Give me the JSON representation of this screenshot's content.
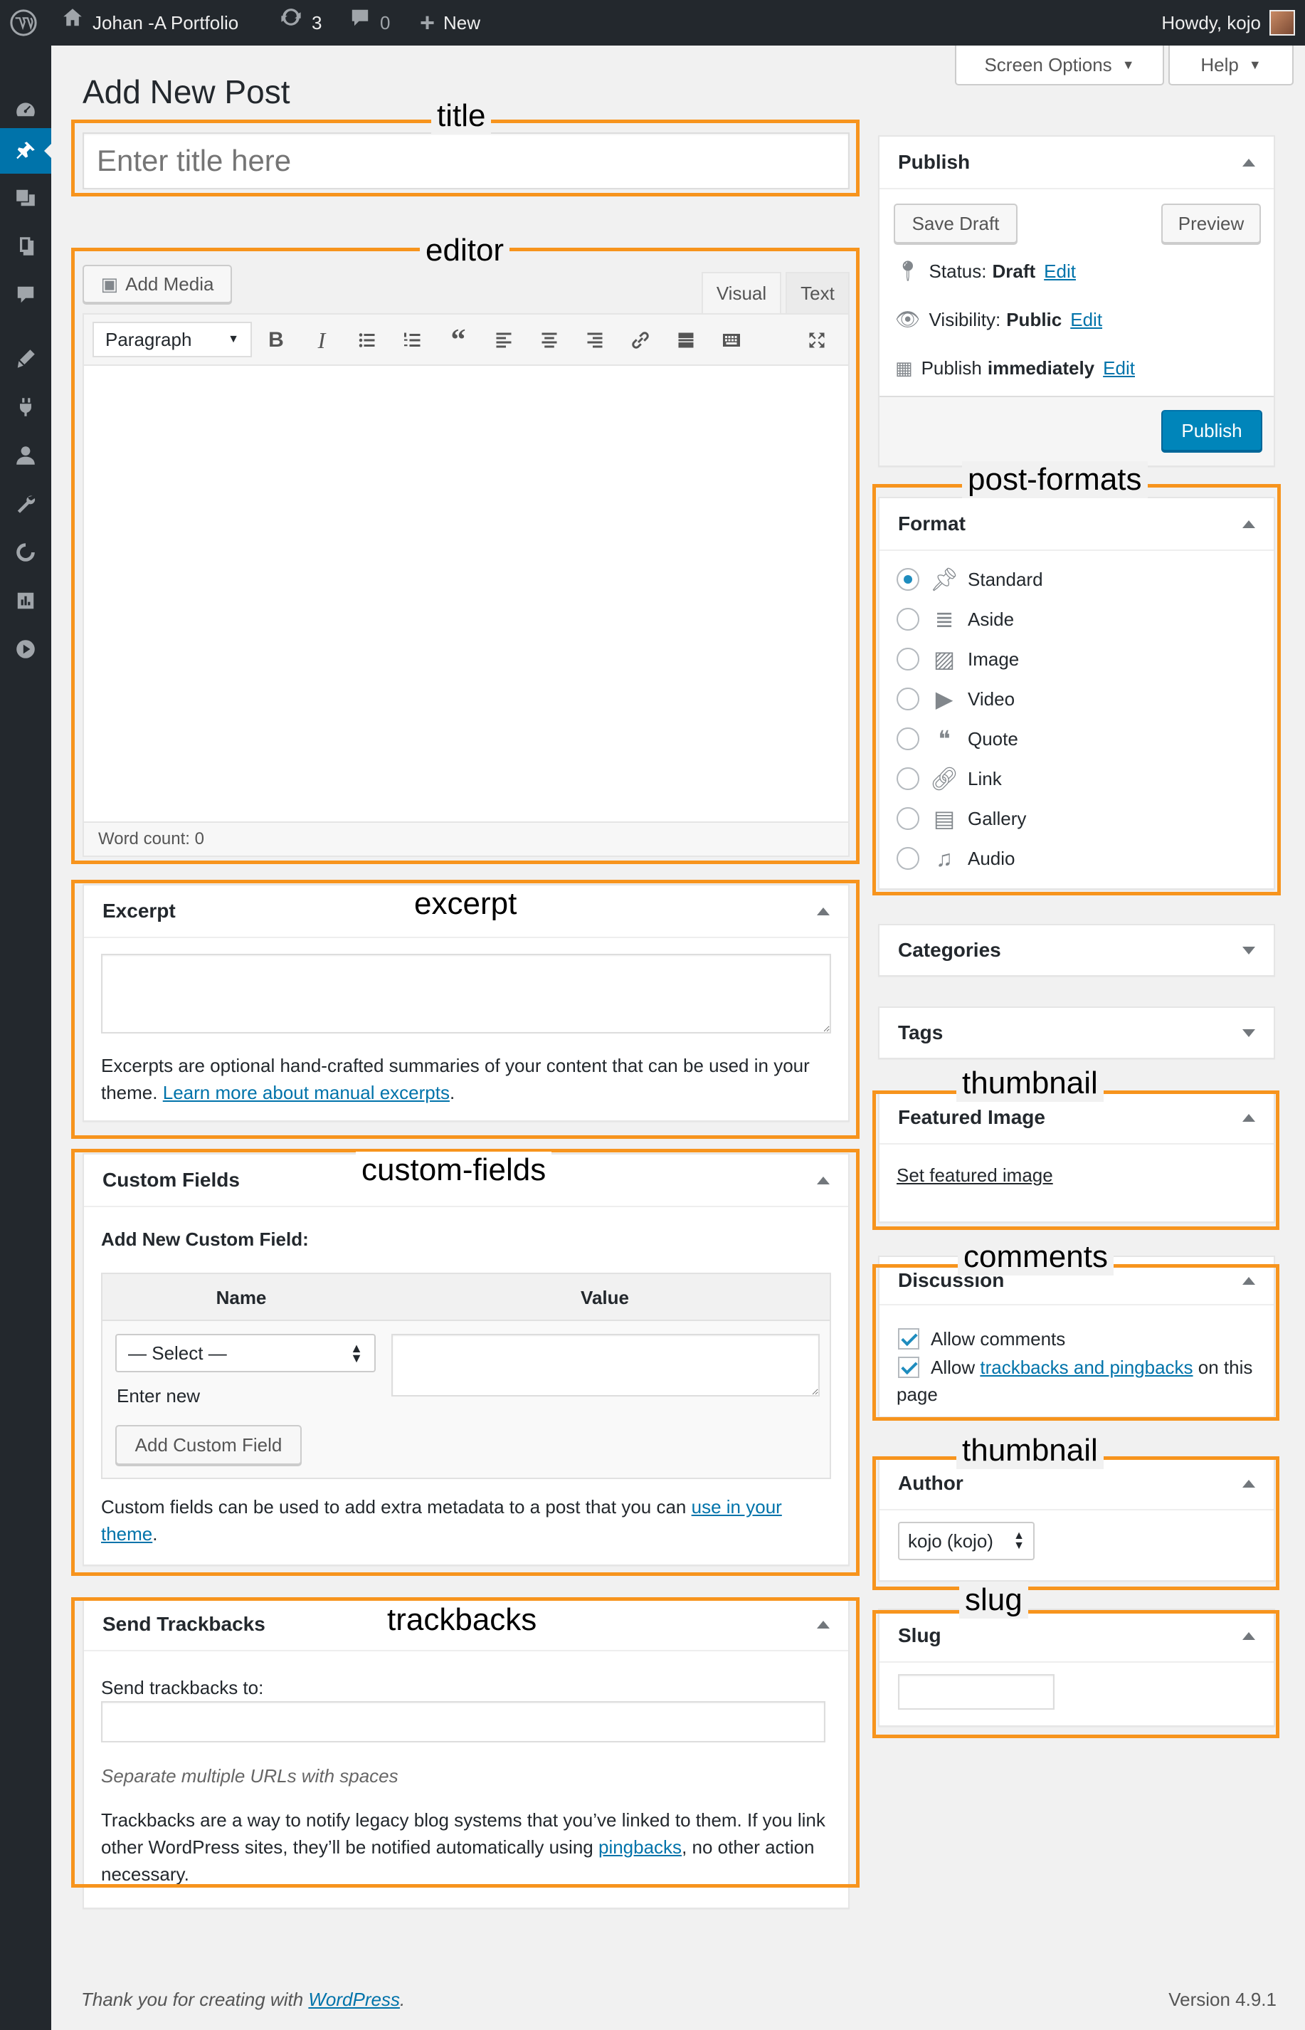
{
  "adminbar": {
    "site_name": "Johan -A Portfolio",
    "updates_count": "3",
    "comments_count": "0",
    "new_label": "New",
    "howdy": "Howdy, kojo"
  },
  "header": {
    "screen_options": "Screen Options",
    "help": "Help",
    "page_title": "Add New Post"
  },
  "title_field": {
    "placeholder": "Enter title here"
  },
  "editor": {
    "add_media": "Add Media",
    "tab_visual": "Visual",
    "tab_text": "Text",
    "format_select": "Paragraph",
    "word_count": "Word count: 0"
  },
  "excerpt": {
    "title": "Excerpt",
    "help_text": "Excerpts are optional hand-crafted summaries of your content that can be used in your theme.",
    "help_link": "Learn more about manual excerpts",
    "help_end": "."
  },
  "custom_fields": {
    "title": "Custom Fields",
    "add_new_label": "Add New Custom Field:",
    "col_name": "Name",
    "col_value": "Value",
    "select_value": "— Select —",
    "enter_new": "Enter new",
    "add_button": "Add Custom Field",
    "help_text": "Custom fields can be used to add extra metadata to a post that you can",
    "help_link": "use in your theme",
    "help_end": "."
  },
  "trackbacks": {
    "title": "Send Trackbacks",
    "label": "Send trackbacks to:",
    "hint": "Separate multiple URLs with spaces",
    "help_text": "Trackbacks are a way to notify legacy blog systems that you’ve linked to them. If you link other WordPress sites, they’ll be notified automatically using",
    "help_link": "pingbacks",
    "help_end": ", no other action necessary."
  },
  "publish": {
    "title": "Publish",
    "save_draft": "Save Draft",
    "preview": "Preview",
    "status_label": "Status:",
    "status_value": "Draft",
    "visibility_label": "Visibility:",
    "visibility_value": "Public",
    "publish_label": "Publish",
    "publish_value": "immediately",
    "edit": "Edit",
    "publish_button": "Publish"
  },
  "format": {
    "title": "Format",
    "options": [
      "Standard",
      "Aside",
      "Image",
      "Video",
      "Quote",
      "Link",
      "Gallery",
      "Audio"
    ],
    "selected": "Standard"
  },
  "categories": {
    "title": "Categories"
  },
  "tags": {
    "title": "Tags"
  },
  "featured_image": {
    "title": "Featured Image",
    "link": "Set featured image"
  },
  "discussion": {
    "title": "Discussion",
    "allow_comments": "Allow comments",
    "allow_prefix": "Allow",
    "trackbacks_link": "trackbacks and pingbacks",
    "allow_suffix": "on this page"
  },
  "author": {
    "title": "Author",
    "value": "kojo (kojo)"
  },
  "slug": {
    "title": "Slug"
  },
  "annotations": {
    "title": "title",
    "editor": "editor",
    "excerpt": "excerpt",
    "custom_fields": "custom-fields",
    "trackbacks": "trackbacks",
    "post_formats": "post-formats",
    "thumbnail": "thumbnail",
    "comments": "comments",
    "thumbnail_author": "thumbnail",
    "slug": "slug"
  },
  "footer": {
    "thanks": "Thank you for creating with",
    "wp_link": "WordPress",
    "end": ".",
    "version": "Version 4.9.1"
  },
  "colors": {
    "accent": "#0073aa",
    "annotation": "#f7941d",
    "adminbar": "#23282d"
  }
}
